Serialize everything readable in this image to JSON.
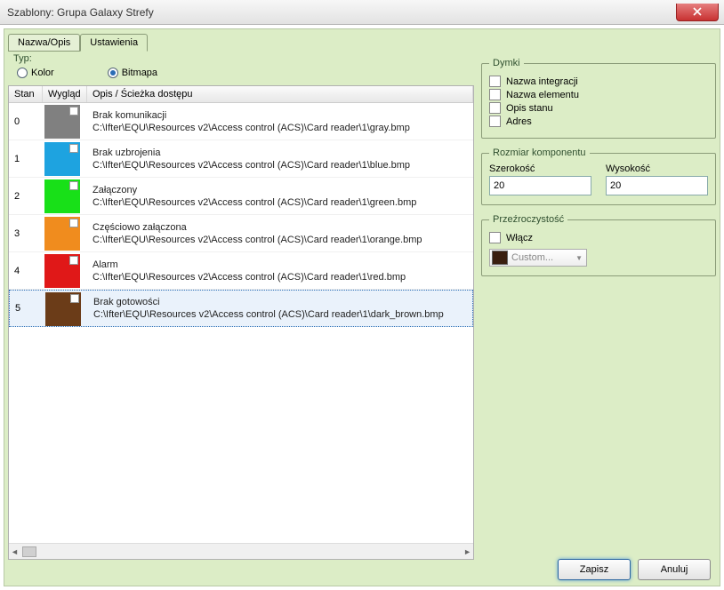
{
  "window": {
    "title": "Szablony: Grupa Galaxy Strefy"
  },
  "tabs": {
    "nazwa": "Nazwa/Opis",
    "ustawienia": "Ustawienia"
  },
  "typ": {
    "label": "Typ:",
    "kolor": "Kolor",
    "bitmapa": "Bitmapa"
  },
  "table": {
    "headers": {
      "stan": "Stan",
      "wyglad": "Wygląd",
      "opis": "Opis / Ścieżka dostępu"
    },
    "rows": [
      {
        "stan": "0",
        "color": "#808080",
        "desc": "Brak komunikacji",
        "path": "C:\\Ifter\\EQU\\Resources v2\\Access control (ACS)\\Card reader\\1\\gray.bmp"
      },
      {
        "stan": "1",
        "color": "#1ea3e0",
        "desc": "Brak uzbrojenia",
        "path": "C:\\Ifter\\EQU\\Resources v2\\Access control (ACS)\\Card reader\\1\\blue.bmp"
      },
      {
        "stan": "2",
        "color": "#18e018",
        "desc": "Załączony",
        "path": "C:\\Ifter\\EQU\\Resources v2\\Access control (ACS)\\Card reader\\1\\green.bmp"
      },
      {
        "stan": "3",
        "color": "#f08c1e",
        "desc": "Częściowo załączona",
        "path": "C:\\Ifter\\EQU\\Resources v2\\Access control (ACS)\\Card reader\\1\\orange.bmp"
      },
      {
        "stan": "4",
        "color": "#e01818",
        "desc": "Alarm",
        "path": "C:\\Ifter\\EQU\\Resources v2\\Access control (ACS)\\Card reader\\1\\red.bmp"
      },
      {
        "stan": "5",
        "color": "#6b3c18",
        "desc": "Brak gotowości",
        "path": "C:\\Ifter\\EQU\\Resources v2\\Access control (ACS)\\Card reader\\1\\dark_brown.bmp"
      }
    ]
  },
  "dymki": {
    "legend": "Dymki",
    "items": {
      "nazwa_integracji": "Nazwa integracji",
      "nazwa_elementu": "Nazwa elementu",
      "opis_stanu": "Opis stanu",
      "adres": "Adres"
    }
  },
  "rozmiar": {
    "legend": "Rozmiar komponentu",
    "szerokosc_label": "Szerokość",
    "wysokosc_label": "Wysokość",
    "szerokosc": "20",
    "wysokosc": "20"
  },
  "przezroczystosc": {
    "legend": "Przeźroczystość",
    "wlacz": "Włącz",
    "custom": "Custom..."
  },
  "buttons": {
    "zapisz": "Zapisz",
    "anuluj": "Anuluj"
  }
}
